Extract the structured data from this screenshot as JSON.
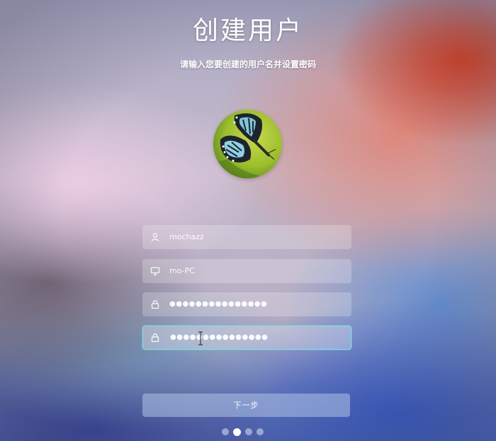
{
  "page": {
    "title": "创建用户",
    "subtitle": "请输入您要创建的用户名并设置密码"
  },
  "avatar": {
    "icon": "butterfly-avatar"
  },
  "form": {
    "username": {
      "icon": "user-icon",
      "value": "mochazz"
    },
    "computer_name": {
      "icon": "computer-icon",
      "value": "mo-PC"
    },
    "password": {
      "icon": "lock-icon",
      "value": "●●●●●●●●●●●●●●●"
    },
    "confirm_password": {
      "icon": "lock-icon",
      "value": "●●●●●●●●●●●●●●●"
    }
  },
  "actions": {
    "next_label": "下一步"
  },
  "progress": {
    "total_steps": 4,
    "current_step": 2
  },
  "colors": {
    "focus_border": "#7fe0e2",
    "accent_red": "#d9452a",
    "accent_blue": "#375cc8"
  }
}
